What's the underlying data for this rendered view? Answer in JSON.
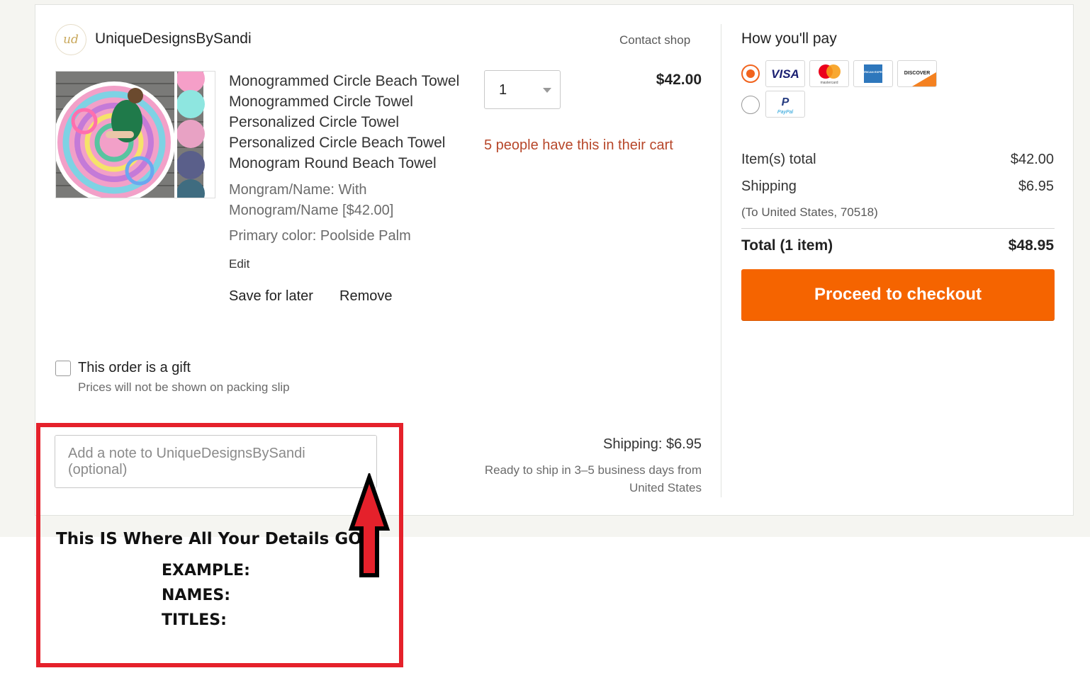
{
  "shop": {
    "logo_text": "ud",
    "name": "UniqueDesignsBySandi",
    "contact_label": "Contact shop"
  },
  "item": {
    "title": "Monogrammed Circle Beach Towel Monogrammed Circle Towel Personalized Circle Towel Personalized Circle Beach Towel Monogram Round Beach Towel",
    "variant": "Mongram/Name: With Monogram/Name [$42.00]",
    "color": "Primary color: Poolside Palm",
    "edit_label": "Edit",
    "save_label": "Save for later",
    "remove_label": "Remove",
    "quantity": "1",
    "price": "$42.00",
    "cart_notice": "5 people have this in their cart"
  },
  "gift": {
    "label": "This order is a gift",
    "sub": "Prices will not be shown on packing slip",
    "checked": false
  },
  "note": {
    "placeholder": "Add a note to UniqueDesignsBySandi (optional)"
  },
  "shipping_info": {
    "label": "Shipping: $6.95",
    "detail": "Ready to ship in 3–5 business days from United States"
  },
  "payment": {
    "heading": "How you'll pay",
    "methods": [
      {
        "icon": "card-group-icon",
        "selected": true,
        "cards": [
          "VISA",
          "mastercard",
          "AMERICAN EXPRESS",
          "DISCOVER"
        ]
      },
      {
        "icon": "paypal-icon",
        "selected": false,
        "cards": [
          "PayPal"
        ]
      }
    ]
  },
  "summary": {
    "items_total_label": "Item(s) total",
    "items_total_value": "$42.00",
    "shipping_label": "Shipping",
    "shipping_value": "$6.95",
    "shipping_sub": "(To United States, 70518)",
    "total_label": "Total (1 item)",
    "total_value": "$48.95",
    "checkout_label": "Proceed to checkout"
  },
  "instructions": {
    "heading": "This IS Where All Your Details GO:",
    "lines": [
      "EXAMPLE:",
      "NAMES:",
      "TITLES:"
    ]
  },
  "colors": {
    "accent": "#f56400",
    "notice": "#b7472a",
    "highlight_box": "#e5212b"
  }
}
